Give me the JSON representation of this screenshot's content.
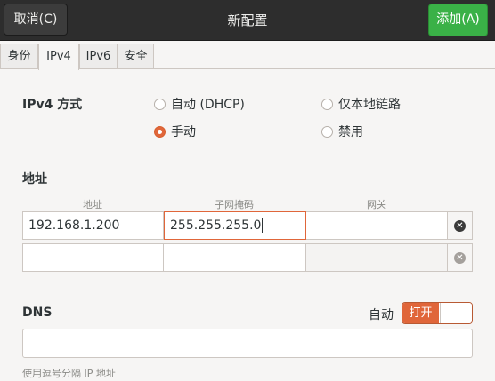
{
  "header": {
    "cancel_label": "取消(C)",
    "title": "新配置",
    "add_label": "添加(A)"
  },
  "tabs": [
    {
      "label": "身份"
    },
    {
      "label": "IPv4"
    },
    {
      "label": "IPv6"
    },
    {
      "label": "安全"
    }
  ],
  "ipv4": {
    "method_label": "IPv4 方式",
    "options": [
      {
        "label": "自动 (DHCP)",
        "selected": false
      },
      {
        "label": "仅本地链路",
        "selected": false
      },
      {
        "label": "手动",
        "selected": true
      },
      {
        "label": "禁用",
        "selected": false
      }
    ]
  },
  "addresses": {
    "section_label": "地址",
    "columns": [
      "地址",
      "子网掩码",
      "网关"
    ],
    "rows": [
      {
        "address": "192.168.1.200",
        "netmask": "255.255.255.0",
        "gateway": ""
      },
      {
        "address": "",
        "netmask": "",
        "gateway": ""
      }
    ]
  },
  "dns": {
    "label": "DNS",
    "auto_label": "自动",
    "toggle_label": "打开",
    "value": "",
    "hint": "使用逗号分隔 IP 地址"
  },
  "colors": {
    "accent": "#e0663a",
    "suggested_action": "#3ab147",
    "headerbar": "#2d2d2d"
  }
}
